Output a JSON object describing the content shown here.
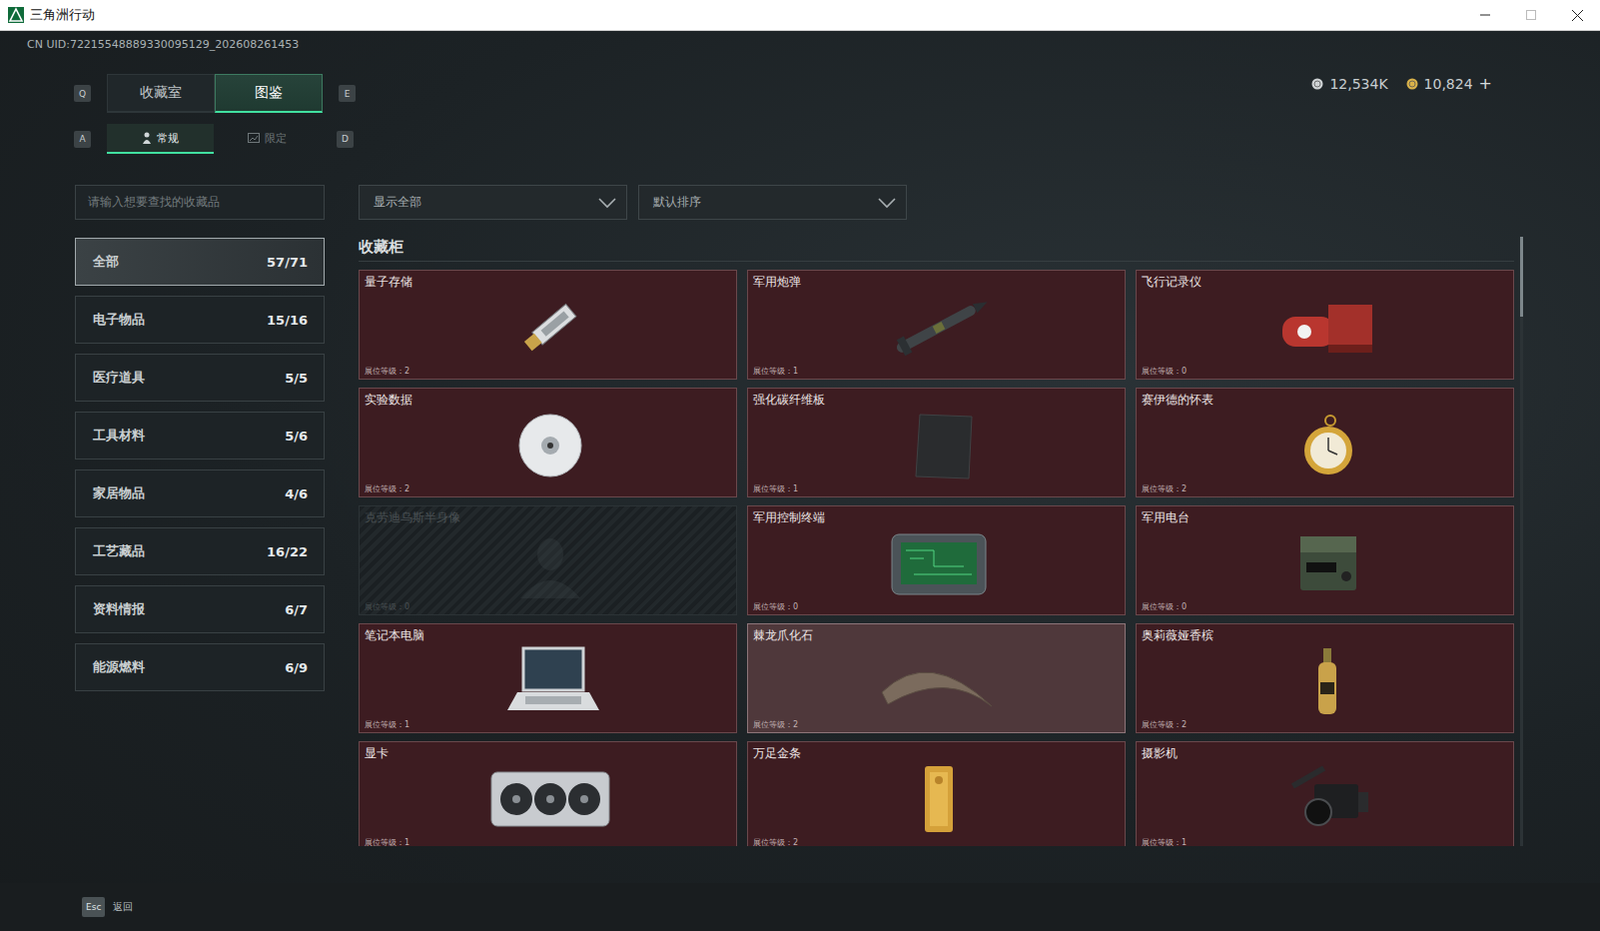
{
  "window": {
    "title": "三角洲行动"
  },
  "uid": "CN UID:72215548889330095129_202608261453",
  "currencies": [
    {
      "value": "12,534K",
      "color": "#cfd3d5"
    },
    {
      "value": "10,824",
      "color": "#d9b24a"
    }
  ],
  "currency_add": "+",
  "main_tabs": {
    "prev_key": "Q",
    "next_key": "E",
    "items": [
      {
        "label": "收藏室",
        "selected": false
      },
      {
        "label": "图鉴",
        "selected": true
      }
    ]
  },
  "sub_tabs": {
    "prev_key": "A",
    "next_key": "D",
    "items": [
      {
        "label": "常规",
        "selected": true
      },
      {
        "label": "限定",
        "selected": false
      }
    ]
  },
  "search": {
    "placeholder": "请输入想要查找的收藏品"
  },
  "filters": [
    {
      "label": "显示全部"
    },
    {
      "label": "默认排序"
    }
  ],
  "categories": [
    {
      "label": "全部",
      "count": "57/71",
      "selected": true
    },
    {
      "label": "电子物品",
      "count": "15/16",
      "selected": false
    },
    {
      "label": "医疗道具",
      "count": "5/5",
      "selected": false
    },
    {
      "label": "工具材料",
      "count": "5/6",
      "selected": false
    },
    {
      "label": "家居物品",
      "count": "4/6",
      "selected": false
    },
    {
      "label": "工艺藏品",
      "count": "16/22",
      "selected": false
    },
    {
      "label": "资料情报",
      "count": "6/7",
      "selected": false
    },
    {
      "label": "能源燃料",
      "count": "6/9",
      "selected": false
    }
  ],
  "section": {
    "title": "收藏柜"
  },
  "items": [
    {
      "name": "量子存储",
      "level_label": "展位等级：2",
      "collected": true,
      "highlighted": false,
      "kind": "usb"
    },
    {
      "name": "军用炮弹",
      "level_label": "展位等级：1",
      "collected": true,
      "highlighted": false,
      "kind": "shell"
    },
    {
      "name": "飞行记录仪",
      "level_label": "展位等级：0",
      "collected": true,
      "highlighted": false,
      "kind": "recorder"
    },
    {
      "name": "实验数据",
      "level_label": "展位等级：2",
      "collected": true,
      "highlighted": false,
      "kind": "disc"
    },
    {
      "name": "强化碳纤维板",
      "level_label": "展位等级：1",
      "collected": true,
      "highlighted": false,
      "kind": "plate"
    },
    {
      "name": "赛伊德的怀表",
      "level_label": "展位等级：2",
      "collected": true,
      "highlighted": false,
      "kind": "watch"
    },
    {
      "name": "克劳迪乌斯半身像",
      "level_label": "展位等级：0",
      "collected": false,
      "highlighted": false,
      "kind": "bust"
    },
    {
      "name": "军用控制终端",
      "level_label": "展位等级：0",
      "collected": true,
      "highlighted": false,
      "kind": "terminal"
    },
    {
      "name": "军用电台",
      "level_label": "展位等级：0",
      "collected": true,
      "highlighted": false,
      "kind": "radio"
    },
    {
      "name": "笔记本电脑",
      "level_label": "展位等级：1",
      "collected": true,
      "highlighted": false,
      "kind": "laptop"
    },
    {
      "name": "棘龙爪化石",
      "level_label": "展位等级：2",
      "collected": true,
      "highlighted": true,
      "kind": "claw"
    },
    {
      "name": "奥莉薇娅香槟",
      "level_label": "展位等级：2",
      "collected": true,
      "highlighted": false,
      "kind": "bottle"
    },
    {
      "name": "显卡",
      "level_label": "展位等级：1",
      "collected": true,
      "highlighted": false,
      "kind": "gpu"
    },
    {
      "name": "万足金条",
      "level_label": "展位等级：2",
      "collected": true,
      "highlighted": false,
      "kind": "gold"
    },
    {
      "name": "摄影机",
      "level_label": "展位等级：1",
      "collected": true,
      "highlighted": false,
      "kind": "camera"
    }
  ],
  "footer": {
    "key": "Esc",
    "label": "返回"
  }
}
